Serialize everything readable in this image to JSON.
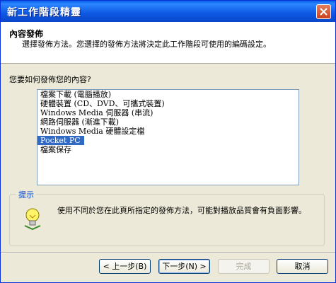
{
  "window": {
    "title": "新工作階段精靈"
  },
  "header": {
    "title": "內容發佈",
    "subtitle": "選擇發佈方法。您選擇的發佈方法將決定此工作階段可使用的編碼設定。"
  },
  "question": "您要如何發佈您的內容?",
  "options": [
    {
      "label": "檔案下載 (電腦播放)",
      "selected": false
    },
    {
      "label": "硬體裝置 (CD、DVD、可攜式裝置)",
      "selected": false
    },
    {
      "label": "Windows Media 伺服器 (串流)",
      "selected": false
    },
    {
      "label": "網路伺服器 (漸進下載)",
      "selected": false
    },
    {
      "label": "Windows Media 硬體設定檔",
      "selected": false
    },
    {
      "label": "Pocket PC",
      "selected": true
    },
    {
      "label": "檔案保存",
      "selected": false
    }
  ],
  "hint": {
    "label": "提示",
    "text": "使用不同於您在此頁所指定的發佈方法，可能對播放品質會有負面影響。",
    "icon": "lightbulb-icon"
  },
  "buttons": {
    "back": "< 上一步(B)",
    "next": "下一步(N) >",
    "finish": "完成",
    "cancel": "取消"
  },
  "colors": {
    "titlebar": "#0a5ee6",
    "selection": "#316ac5",
    "hint_label": "#0046d5"
  }
}
